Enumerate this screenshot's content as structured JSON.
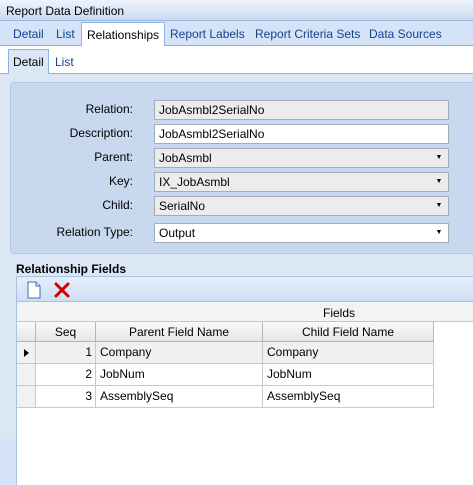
{
  "window": {
    "title": "Report Data Definition"
  },
  "main_tabs": [
    {
      "label": "Detail"
    },
    {
      "label": "List"
    },
    {
      "label": "Relationships"
    },
    {
      "label": "Report Labels"
    },
    {
      "label": "Report Criteria Sets"
    },
    {
      "label": "Data Sources"
    }
  ],
  "sub_tabs": [
    {
      "label": "Detail"
    },
    {
      "label": "List"
    }
  ],
  "form": {
    "relation": {
      "label": "Relation:",
      "value": "JobAsmbl2SerialNo"
    },
    "description": {
      "label": "Description:",
      "value": "JobAsmbl2SerialNo"
    },
    "parent": {
      "label": "Parent:",
      "value": "JobAsmbl"
    },
    "key": {
      "label": "Key:",
      "value": "IX_JobAsmbl"
    },
    "child": {
      "label": "Child:",
      "value": "SerialNo"
    },
    "relation_type": {
      "label": "Relation Type:",
      "value": "Output"
    }
  },
  "relationship_fields": {
    "title": "Relationship Fields",
    "toolbar": {
      "new_icon": "new-document-icon",
      "delete_icon": "delete-x-icon"
    },
    "band_header": "Fields",
    "columns": [
      "Seq",
      "Parent Field Name",
      "Child Field Name"
    ],
    "rows": [
      {
        "seq": "1",
        "parent": "Company",
        "child": "Company"
      },
      {
        "seq": "2",
        "parent": "JobNum",
        "child": "JobNum"
      },
      {
        "seq": "3",
        "parent": "AssemblySeq",
        "child": "AssemblySeq"
      }
    ]
  },
  "colors": {
    "accent": "#15428b",
    "panel_bg": "#dce7f6",
    "delete_red": "#d40000"
  }
}
